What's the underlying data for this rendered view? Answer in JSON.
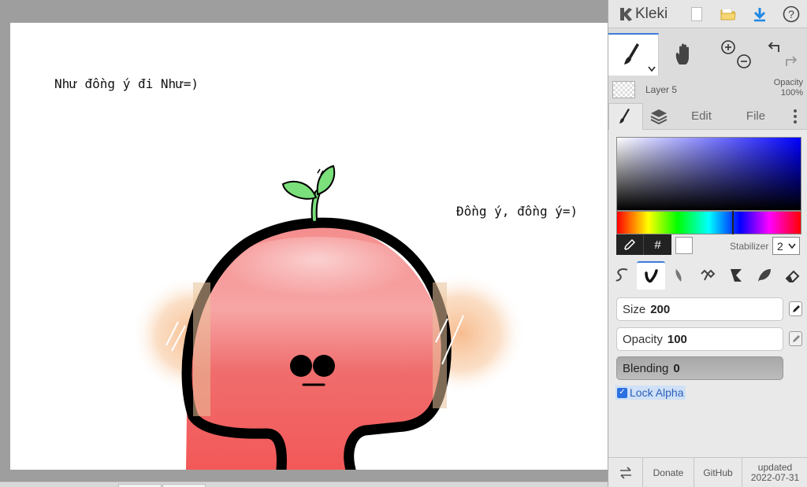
{
  "app": {
    "name": "Kleki"
  },
  "canvas": {
    "text_1": "Như đồng ý đi Như=)",
    "text_2": "Đồng ý, đồng ý=)"
  },
  "layer": {
    "name": "Layer 5",
    "opacity_label": "Opacity",
    "opacity_value": "100%"
  },
  "tabs": {
    "edit": "Edit",
    "file": "File"
  },
  "color": {
    "hex_symbol": "#",
    "current": "#ffffff",
    "stabilizer_label": "Stabilizer",
    "stabilizer_value": "2"
  },
  "brush": {
    "size_label": "Size",
    "size_value": "200",
    "opacity_label": "Opacity",
    "opacity_value": "100",
    "blending_label": "Blending",
    "blending_value": "0",
    "lock_alpha_label": "Lock Alpha",
    "lock_alpha_checked": true
  },
  "footer": {
    "donate": "Donate",
    "github": "GitHub",
    "updated_label": "updated",
    "updated_date": "2022-07-31"
  },
  "colors": {
    "accent": "#3b7bd8",
    "folder": "#f2c94c",
    "download": "#1e88e5",
    "leaf": "#7be07b"
  }
}
